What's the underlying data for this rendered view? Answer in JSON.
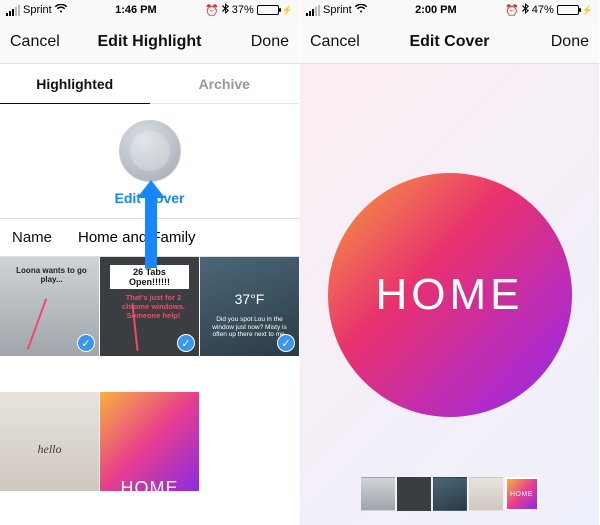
{
  "left": {
    "status": {
      "carrier": "Sprint",
      "time": "1:46 PM",
      "battery_pct": "37%",
      "battery_fill": "37%"
    },
    "nav": {
      "cancel": "Cancel",
      "title": "Edit Highlight",
      "done": "Done"
    },
    "tabs": {
      "highlighted": "Highlighted",
      "archive": "Archive"
    },
    "cover": {
      "edit_cover": "Edit Cover"
    },
    "name": {
      "label": "Name",
      "value": "Home and Family"
    },
    "thumbs": {
      "0": {
        "caption": "Loona wants to go play..."
      },
      "1": {
        "tabs_text": "26 Tabs Open!!!!!!",
        "sub": "That's just for 2 chrome windows. Someone help!"
      },
      "2": {
        "temp": "37°F",
        "sub2": "Did you spot Lou in the window just now? Misty is often up there next to me."
      },
      "3": {
        "caption": "hello"
      },
      "4": {
        "text": "HOME"
      }
    }
  },
  "right": {
    "status": {
      "carrier": "Sprint",
      "time": "2:00 PM",
      "battery_pct": "47%",
      "battery_fill": "47%"
    },
    "nav": {
      "cancel": "Cancel",
      "title": "Edit Cover",
      "done": "Done"
    },
    "big_text": "HOME",
    "filmstrip": {
      "4": {
        "label": "HOME"
      }
    }
  }
}
